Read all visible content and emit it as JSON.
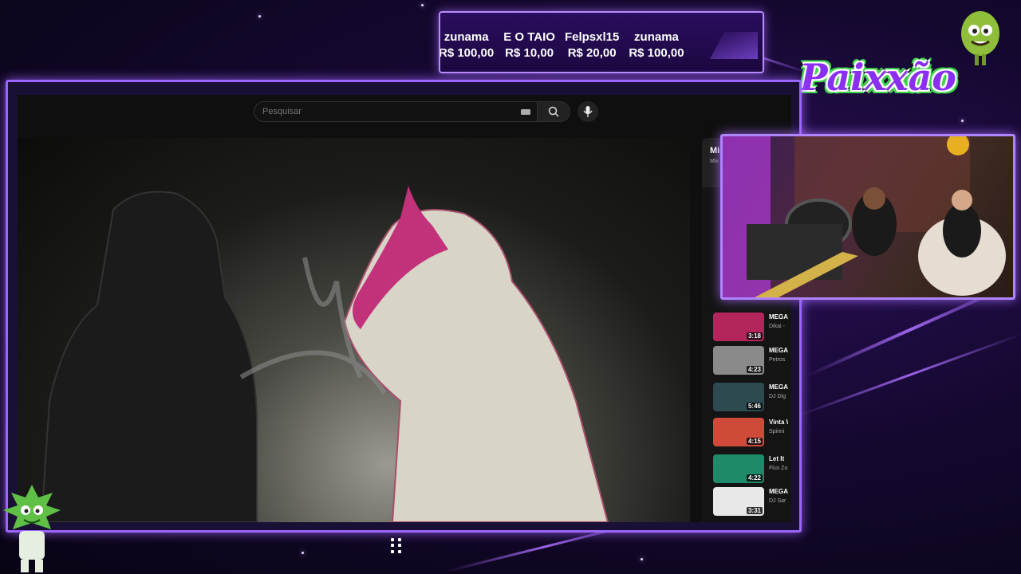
{
  "ticker": {
    "donations": [
      {
        "name": "zunama",
        "amount": "R$ 100,00"
      },
      {
        "name": "E O TAIO",
        "amount": "R$ 10,00"
      },
      {
        "name": "Felpsxl15",
        "amount": "R$ 20,00"
      },
      {
        "name": "zunama",
        "amount": "R$ 100,00"
      }
    ]
  },
  "logo": {
    "text": "Paixxão"
  },
  "browser": {
    "search": {
      "placeholder": "Pesquisar",
      "value": ""
    },
    "playlist": {
      "title": "Mi",
      "subtitle": "Mix",
      "items": [
        {
          "title": "MEGA",
          "channel": "Dikai -",
          "duration": "3:18",
          "thumb_color": "#b2265c"
        },
        {
          "title": "MEGA PETR",
          "channel": "Petros",
          "duration": "4:23",
          "thumb_color": "#8a8a8a"
        },
        {
          "title": "MEGA DIFER",
          "channel": "DJ Dig",
          "duration": "5:46",
          "thumb_color": "#2c4a50"
        },
        {
          "title": "Vinta Will F",
          "channel": "Spinni",
          "duration": "4:15",
          "thumb_color": "#d04a3a"
        },
        {
          "title": "Let It",
          "channel": "Flux Zo",
          "duration": "4:22",
          "thumb_color": "#1f8a6a"
        },
        {
          "title": "MEGA CAMI",
          "channel": "DJ Sar",
          "duration": "3:31",
          "thumb_color": "#e8e8e8"
        }
      ]
    }
  },
  "colors": {
    "accent": "#9b66ff",
    "ticker_bg": "#2b0d5e",
    "logo_purple": "#8a2ef0",
    "logo_green": "#3fd64a"
  }
}
